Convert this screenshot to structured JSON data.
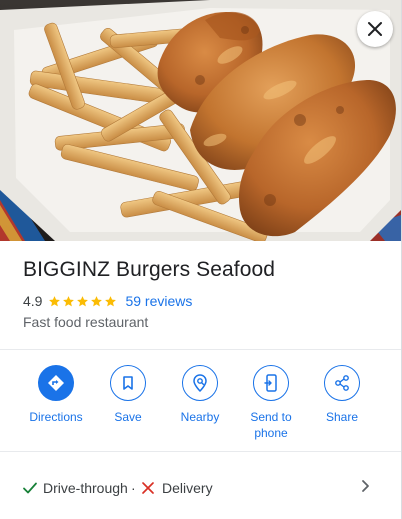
{
  "place": {
    "name": "BIGGINZ Burgers Seafood",
    "rating": "4.9",
    "star_count": 5,
    "reviews_label": "59 reviews",
    "category": "Fast food restaurant"
  },
  "actions": [
    {
      "label": "Directions",
      "icon": "directions-icon"
    },
    {
      "label": "Save",
      "icon": "bookmark-icon"
    },
    {
      "label": "Nearby",
      "icon": "nearby-pin-icon"
    },
    {
      "label": "Send to phone",
      "icon": "phone-icon"
    },
    {
      "label": "Share",
      "icon": "share-icon"
    }
  ],
  "attributes": [
    {
      "label": "Drive-through",
      "available": true,
      "icon": "check-icon"
    },
    {
      "label": "Delivery",
      "available": false,
      "icon": "cross-icon"
    }
  ],
  "attribute_separator": "·",
  "colors": {
    "accent": "#1a73e8",
    "star": "#fbbc04",
    "check": "#188038",
    "cross": "#d93025",
    "text": "#202124",
    "secondary": "#5f6368"
  }
}
